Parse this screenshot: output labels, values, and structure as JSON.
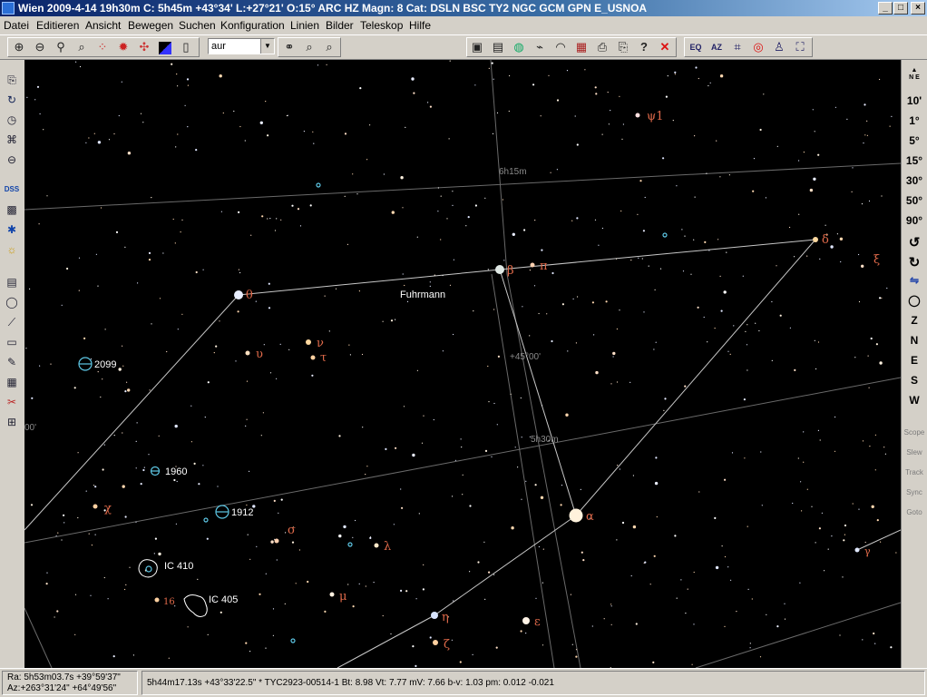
{
  "window": {
    "title": "Wien 2009-4-14  19h30m C:  5h45m +43°34' L:+27°21' O:15° ARC HZ  Magn: 8 Cat: DSLN BSC TY2 NGC GCM GPN  E_USNOA",
    "minimize": "_",
    "maximize": "□",
    "close": "×"
  },
  "menu": [
    "Datei",
    "Editieren",
    "Ansicht",
    "Bewegen",
    "Suchen",
    "Konfiguration",
    "Linien",
    "Bilder",
    "Teleskop",
    "Hilfe"
  ],
  "toolbar": {
    "search_value": "aur",
    "help_label": "?"
  },
  "right_toolbar": {
    "fov": [
      "10'",
      "1°",
      "5°",
      "15°",
      "30°",
      "50°",
      "90°"
    ],
    "directions": [
      "Z",
      "N",
      "E",
      "S",
      "W"
    ],
    "telescope": [
      "Scope",
      "Slew",
      "Track",
      "Sync",
      "Goto"
    ]
  },
  "left_toolbar": {
    "dss_label": "DSS"
  },
  "sky": {
    "constellation": "Fuhrmann",
    "grid_labels": [
      "6h15m",
      "5h30m",
      "+45°00'",
      "00'"
    ],
    "star_labels": [
      "θ",
      "β",
      "π",
      "δ",
      "ξ",
      "ψ1",
      "ν",
      "τ",
      "υ",
      "α",
      "χ",
      "σ",
      "λ",
      "μ",
      "η",
      "ζ",
      "ε",
      "16",
      "γ"
    ],
    "dso_labels": [
      "2099",
      "1960",
      "1912",
      "IC 410",
      "IC 405"
    ],
    "colors": {
      "background": "#000000",
      "grid": "#6a6a6a",
      "constellation_line": "#c8c8c8",
      "star_label": "#e06a4a",
      "cluster": "#5ec8e6",
      "nebula": "#ffffff",
      "dso_label": "#ffffff"
    }
  },
  "status": {
    "ra": "Ra:  5h53m03.7s +39°59'37\"",
    "az": "Az:+263°31'24\" +64°49'56\"",
    "object": "5h44m17.13s +43°33'22.5\"   * TYC2923-00514-1 Bt: 8.98 Vt: 7.77 mV: 7.66 b-v: 1.03 pm: 0.012 -0.021"
  }
}
